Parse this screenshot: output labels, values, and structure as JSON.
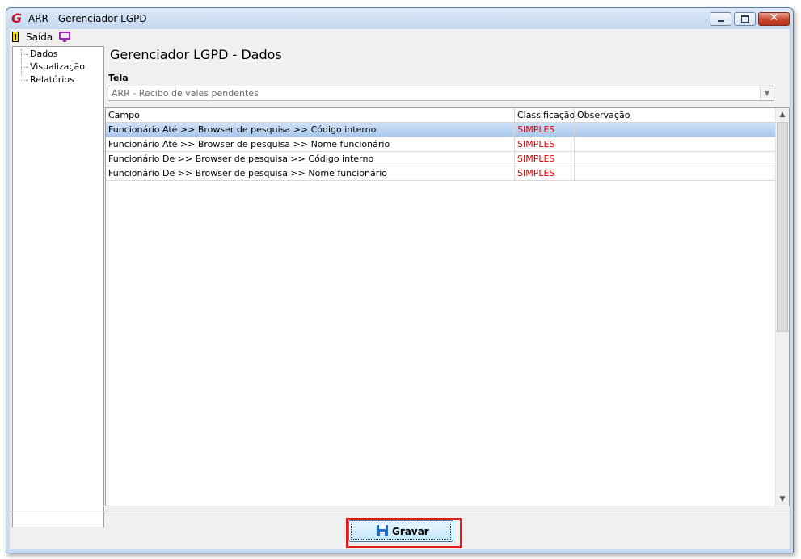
{
  "window": {
    "title": "ARR - Gerenciador LGPD",
    "logo_icon": "app-logo-icon",
    "controls": {
      "minimize_icon": "minimize-icon",
      "maximize_icon": "maximize-icon",
      "close_icon": "close-icon"
    }
  },
  "menu": {
    "exit_label": "Saída",
    "exit_icon": "exit-door-icon",
    "display_icon": "monitor-icon"
  },
  "sidebar": {
    "items": [
      {
        "label": "Dados"
      },
      {
        "label": "Visualização"
      },
      {
        "label": "Relatórios"
      }
    ]
  },
  "main": {
    "title": "Gerenciador LGPD - Dados",
    "tela_label": "Tela",
    "tela_value": "ARR - Recibo de vales pendentes",
    "grid": {
      "columns": [
        "Campo",
        "Classificação",
        "Observação"
      ],
      "rows": [
        {
          "campo": "Funcionário Até >> Browser de pesquisa >> Código interno",
          "classificacao": "SIMPLES",
          "observacao": "",
          "selected": true
        },
        {
          "campo": "Funcionário Até >> Browser de pesquisa >> Nome funcionário",
          "classificacao": "SIMPLES",
          "observacao": "",
          "selected": false
        },
        {
          "campo": "Funcionário De >> Browser de pesquisa >> Código interno",
          "classificacao": "SIMPLES",
          "observacao": "",
          "selected": false
        },
        {
          "campo": "Funcionário De >> Browser de pesquisa >> Nome funcionário",
          "classificacao": "SIMPLES",
          "observacao": "",
          "selected": false
        }
      ]
    }
  },
  "footer": {
    "save_mnemonic": "G",
    "save_rest": "ravar",
    "save_icon": "floppy-disk-icon"
  },
  "colors": {
    "classification_text": "#e00000",
    "highlight_border": "#e01b1b",
    "selected_row": "#a9c8ee"
  }
}
